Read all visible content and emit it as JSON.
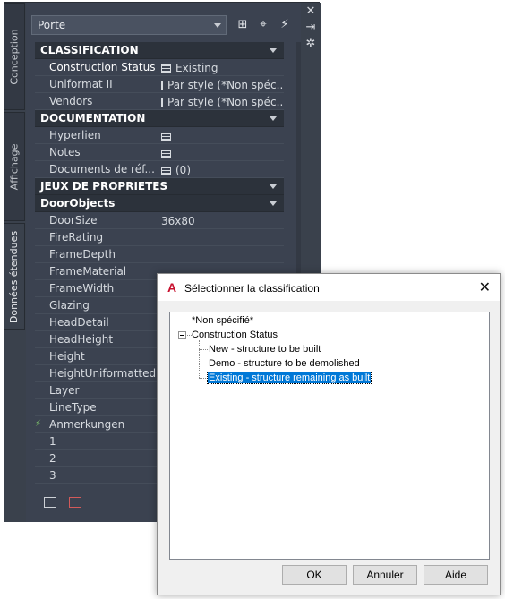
{
  "palette": {
    "side_tabs": [
      "Conception",
      "Affichage",
      "Données étendues"
    ],
    "style_selector": "Porte",
    "toolbar_icons": [
      "add-style-icon",
      "select-objects-icon",
      "quick-select-icon"
    ],
    "right_strip_icons": [
      "close-icon",
      "auto-hide-icon",
      "properties-icon"
    ],
    "sections": [
      {
        "title": "CLASSIFICATION",
        "rows": [
          {
            "name": "Construction Status",
            "value": "Existing",
            "has_table_icon": true
          },
          {
            "name": "Uniformat II",
            "value": "Par style (*Non spéc...",
            "has_table_icon": true
          },
          {
            "name": "Vendors",
            "value": "Par style (*Non spéc...",
            "has_table_icon": true
          }
        ]
      },
      {
        "title": "DOCUMENTATION",
        "rows": [
          {
            "name": "Hyperlien",
            "value": "",
            "has_table_icon": true
          },
          {
            "name": "Notes",
            "value": "",
            "has_table_icon": true
          },
          {
            "name": "Documents de réf...",
            "value": "(0)",
            "has_table_icon": true
          }
        ]
      },
      {
        "title": "JEUX DE PROPRIETES",
        "rows": []
      },
      {
        "title": "DoorObjects",
        "rows": [
          {
            "name": "DoorSize",
            "value": "36x80"
          },
          {
            "name": "FireRating",
            "value": ""
          },
          {
            "name": "FrameDepth",
            "value": ""
          },
          {
            "name": "FrameMaterial",
            "value": ""
          },
          {
            "name": "FrameWidth",
            "value": ""
          },
          {
            "name": "Glazing",
            "value": ""
          },
          {
            "name": "HeadDetail",
            "value": ""
          },
          {
            "name": "HeadHeight",
            "value": ""
          },
          {
            "name": "Height",
            "value": ""
          },
          {
            "name": "HeightUniformatted",
            "value": ""
          },
          {
            "name": "Layer",
            "value": ""
          },
          {
            "name": "LineType",
            "value": ""
          },
          {
            "name": "Anmerkungen",
            "value": ""
          },
          {
            "name": "1",
            "value": ""
          },
          {
            "name": "2",
            "value": ""
          },
          {
            "name": "3",
            "value": ""
          }
        ]
      }
    ]
  },
  "dialog": {
    "title": "Sélectionner la classification",
    "tree": [
      {
        "label": "*Non spécifié*",
        "level": 0
      },
      {
        "label": "Construction Status",
        "level": 0
      },
      {
        "label": "New - structure to be built",
        "level": 1
      },
      {
        "label": "Demo - structure to be demolished",
        "level": 1
      },
      {
        "label": "Existing - structure remaining as built",
        "level": 1,
        "selected": true
      }
    ],
    "buttons": {
      "ok": "OK",
      "cancel": "Annuler",
      "help": "Aide"
    }
  },
  "colors": {
    "palette_bg": "#3b4250",
    "section_bg": "#2c323b",
    "selection": "#0078d7"
  }
}
